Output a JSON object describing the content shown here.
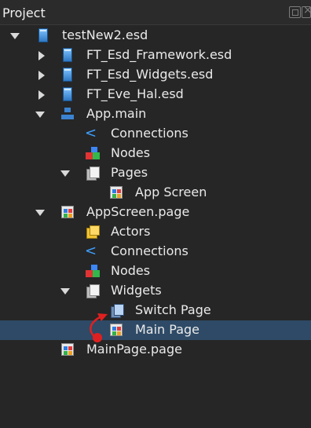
{
  "panel": {
    "title": "Project"
  },
  "tree": [
    {
      "label": "testNew2.esd",
      "icon": "esd-file-icon",
      "expander": "expanded"
    },
    {
      "label": "FT_Esd_Framework.esd",
      "icon": "esd-file-icon",
      "expander": "collapsed"
    },
    {
      "label": "FT_Esd_Widgets.esd",
      "icon": "esd-file-icon",
      "expander": "collapsed"
    },
    {
      "label": "FT_Eve_Hal.esd",
      "icon": "esd-file-icon",
      "expander": "collapsed"
    },
    {
      "label": "App.main",
      "icon": "app-main-icon",
      "expander": "expanded"
    },
    {
      "label": "Connections",
      "icon": "connections-icon",
      "expander": "none"
    },
    {
      "label": "Nodes",
      "icon": "nodes-icon",
      "expander": "none"
    },
    {
      "label": "Pages",
      "icon": "pages-icon",
      "expander": "expanded"
    },
    {
      "label": "App Screen",
      "icon": "screen-icon",
      "expander": "none"
    },
    {
      "label": "AppScreen.page",
      "icon": "screen-icon",
      "expander": "expanded"
    },
    {
      "label": "Actors",
      "icon": "actors-icon",
      "expander": "none"
    },
    {
      "label": "Connections",
      "icon": "connections-icon",
      "expander": "none"
    },
    {
      "label": "Nodes",
      "icon": "nodes-icon",
      "expander": "none"
    },
    {
      "label": "Widgets",
      "icon": "pages-icon",
      "expander": "expanded"
    },
    {
      "label": "Switch Page",
      "icon": "switch-page-icon",
      "expander": "none"
    },
    {
      "label": "Main Page",
      "icon": "screen-icon",
      "expander": "none",
      "selected": true
    },
    {
      "label": "MainPage.page",
      "icon": "screen-icon",
      "expander": "none"
    }
  ],
  "colors": {
    "background": "#262626",
    "selection": "#2e4a66",
    "text": "#eaeaea",
    "drag_indicator": "#e02020"
  }
}
